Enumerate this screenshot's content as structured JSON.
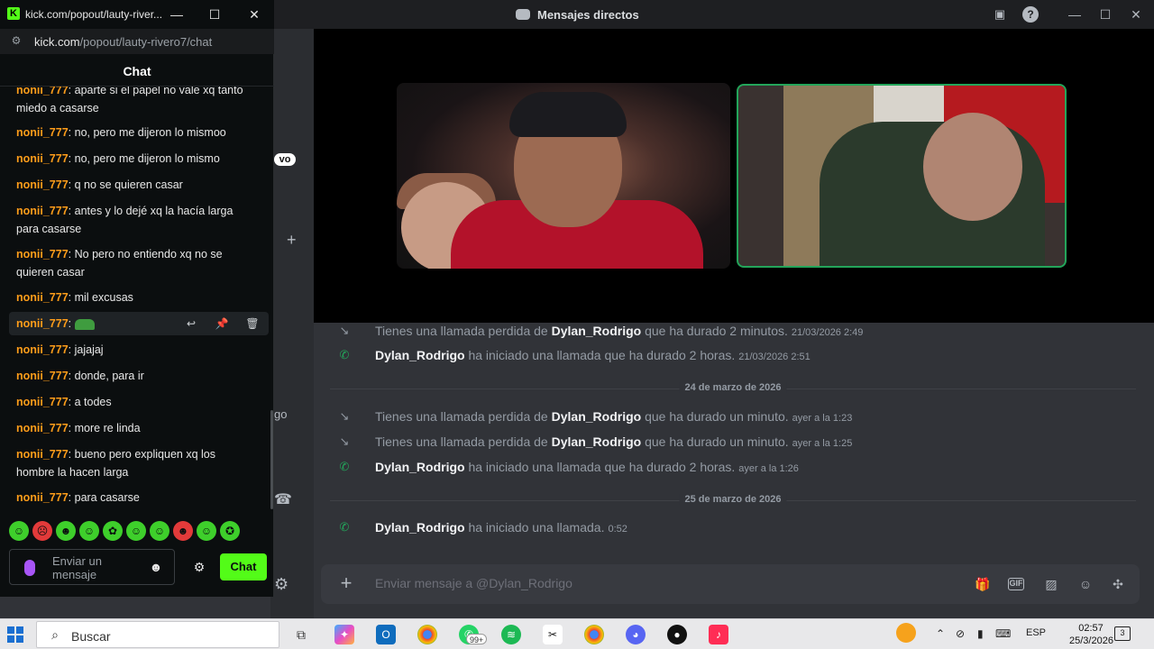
{
  "discord": {
    "window_title": "Mensajes directos",
    "behind": {
      "fragment_1": "vo",
      "fragment_2": "go"
    },
    "call_log": [
      {
        "type": "missed",
        "prefix": "Tienes una llamada perdida de",
        "user": "Dylan_Rodrigo",
        "suffix": "que ha durado 2 minutos.",
        "time": "21/03/2026 2:49"
      },
      {
        "type": "started",
        "prefix": "",
        "user": "Dylan_Rodrigo",
        "suffix": "ha iniciado una llamada que ha durado 2 horas.",
        "time": "21/03/2026 2:51"
      },
      {
        "type": "date",
        "label": "24 de marzo de 2026"
      },
      {
        "type": "missed",
        "prefix": "Tienes una llamada perdida de",
        "user": "Dylan_Rodrigo",
        "suffix": "que ha durado un minuto.",
        "time": "ayer a la 1:23"
      },
      {
        "type": "missed",
        "prefix": "Tienes una llamada perdida de",
        "user": "Dylan_Rodrigo",
        "suffix": "que ha durado un minuto.",
        "time": "ayer a la 1:25"
      },
      {
        "type": "started",
        "prefix": "",
        "user": "Dylan_Rodrigo",
        "suffix": "ha iniciado una llamada que ha durado 2 horas.",
        "time": "ayer a la 1:26"
      },
      {
        "type": "date",
        "label": "25 de marzo de 2026"
      },
      {
        "type": "started",
        "prefix": "",
        "user": "Dylan_Rodrigo",
        "suffix": "ha iniciado una llamada.",
        "time": "0:52"
      }
    ],
    "composer_placeholder": "Enviar mensaje a @Dylan_Rodrigo",
    "accent_green": "#23a55a"
  },
  "kick": {
    "window_title": "kick.com/popout/lauty-river...",
    "url_host": "kick.com",
    "url_path": "/popout/lauty-rivero7/chat",
    "chat_header": "Chat",
    "messages": [
      {
        "user": "nonii_777",
        "text": ": aparte si el papel no vale xq tanto miedo a casarse"
      },
      {
        "user": "nonii_777",
        "text": ": no, pero me dijeron lo mismoo"
      },
      {
        "user": "nonii_777",
        "text": ": no, pero me dijeron lo mismo"
      },
      {
        "user": "nonii_777",
        "text": ": q no se quieren casar"
      },
      {
        "user": "nonii_777",
        "text": ": antes y lo dejé xq la hacía larga para casarse"
      },
      {
        "user": "nonii_777",
        "text": ": No pero no entiendo xq no se quieren casar"
      },
      {
        "user": "nonii_777",
        "text": ": mil excusas"
      },
      {
        "user": "nonii_777",
        "text": ":"
      },
      {
        "user": "nonii_777",
        "text": ": jajajaj"
      },
      {
        "user": "nonii_777",
        "text": ": donde, para ir"
      },
      {
        "user": "nonii_777",
        "text": ": a todes"
      },
      {
        "user": "nonii_777",
        "text": ": more re linda"
      },
      {
        "user": "nonii_777",
        "text": ": bueno pero expliquen xq los hombre la hacen larga"
      },
      {
        "user": "nonii_777",
        "text": ": para casarse"
      }
    ],
    "input_placeholder": "Enviar un mensaje",
    "send_label": "Chat",
    "accent": "#53fc18",
    "username_color": "#ff9d1a"
  },
  "taskbar": {
    "search_placeholder": "Buscar",
    "whatsapp_badge": "99+",
    "language": "ESP",
    "time": "02:57",
    "date": "25/3/2026",
    "notifications": "3"
  }
}
